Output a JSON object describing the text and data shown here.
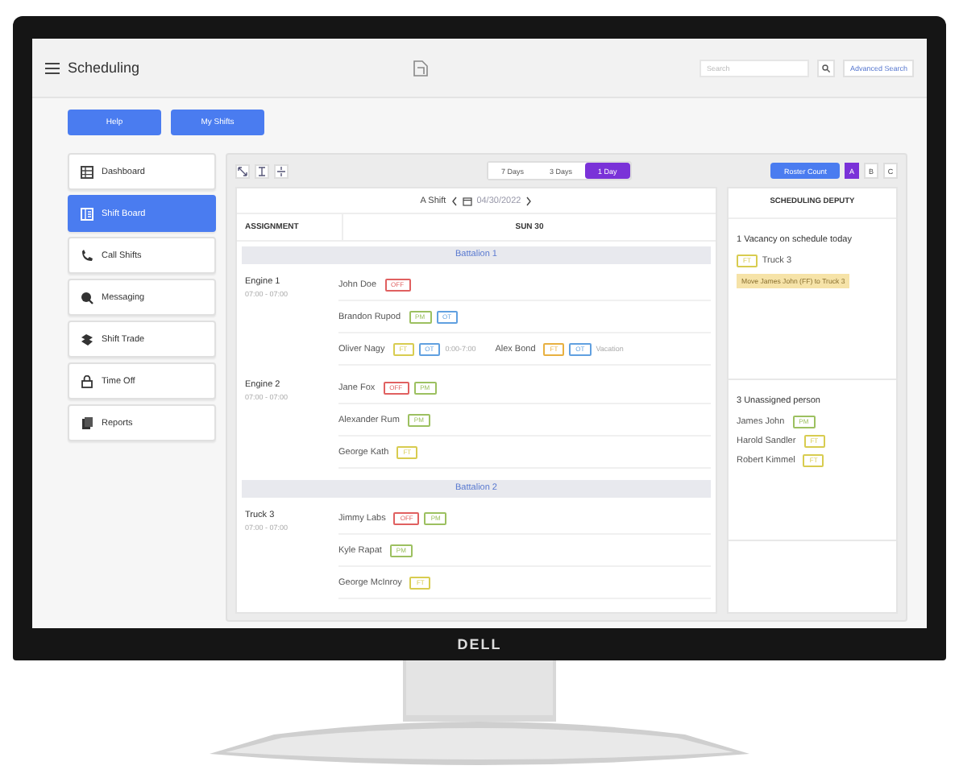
{
  "monitor": {
    "brand": "DELL"
  },
  "header": {
    "title": "Scheduling",
    "search_placeholder": "Search",
    "advanced_search": "Advanced Search"
  },
  "top_buttons": [
    "Help",
    "My Shifts"
  ],
  "sidebar": {
    "items": [
      {
        "label": "Dashboard",
        "selected": false
      },
      {
        "label": "Shift Board",
        "selected": true
      },
      {
        "label": "Call Shifts",
        "selected": false
      },
      {
        "label": "Messaging",
        "selected": false
      },
      {
        "label": "Shift Trade",
        "selected": false
      },
      {
        "label": "Time Off",
        "selected": false
      },
      {
        "label": "Reports",
        "selected": false
      }
    ]
  },
  "view_switch": [
    {
      "label": "7 Days",
      "selected": false
    },
    {
      "label": "3 Days",
      "selected": false
    },
    {
      "label": "1 Day",
      "selected": true
    }
  ],
  "roster_button": "Roster Count",
  "shift_switch": [
    {
      "label": "A",
      "selected": true
    },
    {
      "label": "B",
      "selected": false
    },
    {
      "label": "C",
      "selected": false
    }
  ],
  "board": {
    "shift_label": "A Shift",
    "date": "04/30/2022",
    "columns": [
      "ASSIGNMENT",
      "SUN 30"
    ],
    "groups": [
      {
        "title": "Battalion 1",
        "units": [
          {
            "name": "Engine 1",
            "time": "07:00 - 07:00",
            "rows": [
              [
                {
                  "name": "John Doe",
                  "tags": [
                    {
                      "text": "OFF",
                      "color": "#e06060"
                    }
                  ]
                }
              ],
              [
                {
                  "name": "Brandon Rupod",
                  "tags": [
                    {
                      "text": "PM",
                      "color": "#9cc060"
                    },
                    {
                      "text": "OT",
                      "color": "#60a0e0"
                    }
                  ]
                }
              ],
              [
                {
                  "name": "Oliver Nagy",
                  "tags": [
                    {
                      "text": "FT",
                      "color": "#d8cc50"
                    },
                    {
                      "text": "OT",
                      "color": "#60a0e0"
                    }
                  ],
                  "note": "0:00-7:00"
                },
                {
                  "name": "Alex Bond",
                  "tags": [
                    {
                      "text": "FT",
                      "color": "#e8b040"
                    },
                    {
                      "text": "OT",
                      "color": "#60a0e0"
                    }
                  ],
                  "note": "Vacation"
                }
              ]
            ]
          },
          {
            "name": "Engine 2",
            "time": "07:00 - 07:00",
            "rows": [
              [
                {
                  "name": "Jane Fox",
                  "tags": [
                    {
                      "text": "OFF",
                      "color": "#e06060"
                    },
                    {
                      "text": "PM",
                      "color": "#9cc060"
                    }
                  ]
                }
              ],
              [
                {
                  "name": "Alexander Rum",
                  "tags": [
                    {
                      "text": "PM",
                      "color": "#9cc060"
                    }
                  ]
                }
              ],
              [
                {
                  "name": "George Kath",
                  "tags": [
                    {
                      "text": "FT",
                      "color": "#d8cc50"
                    }
                  ]
                }
              ]
            ]
          }
        ]
      },
      {
        "title": "Battalion 2",
        "units": [
          {
            "name": "Truck 3",
            "time": "07:00 - 07:00",
            "rows": [
              [
                {
                  "name": "Jimmy Labs",
                  "tags": [
                    {
                      "text": "OFF",
                      "color": "#e06060"
                    },
                    {
                      "text": "PM",
                      "color": "#9cc060"
                    }
                  ]
                }
              ],
              [
                {
                  "name": "Kyle Rapat",
                  "tags": [
                    {
                      "text": "PM",
                      "color": "#9cc060"
                    }
                  ]
                }
              ],
              [
                {
                  "name": "George McInroy",
                  "tags": [
                    {
                      "text": "FT",
                      "color": "#d8cc50"
                    }
                  ]
                }
              ]
            ]
          }
        ]
      }
    ]
  },
  "deputy": {
    "title": "SCHEDULING DEPUTY",
    "sections": [
      {
        "heading": "1 Vacancy on schedule today",
        "items": [
          {
            "kind": "vacancy",
            "name": "Truck 3",
            "tags": [
              {
                "text": "FT",
                "color": "#d8cc50"
              }
            ]
          }
        ],
        "alert": "Move James John (FF) to Truck 3"
      },
      {
        "heading": "3 Unassigned person",
        "items": [
          {
            "kind": "person",
            "name": "James John",
            "tags": [
              {
                "text": "PM",
                "color": "#9cc060"
              }
            ]
          },
          {
            "kind": "person",
            "name": "Harold Sandler",
            "tags": [
              {
                "text": "FT",
                "color": "#d8cc50"
              }
            ]
          },
          {
            "kind": "person",
            "name": "Robert Kimmel",
            "tags": [
              {
                "text": "FT",
                "color": "#d8cc50"
              }
            ]
          }
        ]
      }
    ]
  }
}
